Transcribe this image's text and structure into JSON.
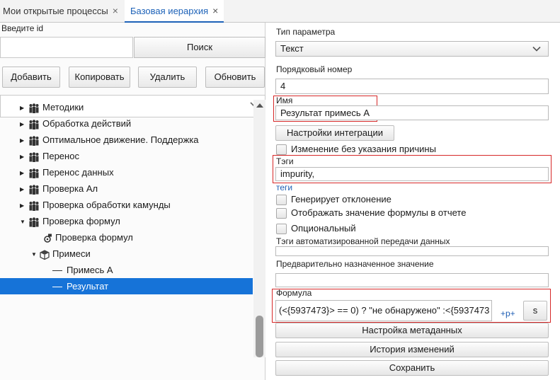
{
  "tabs": [
    {
      "label": "Мои открытые процессы",
      "close": "×"
    },
    {
      "label": "Базовая иерархия",
      "close": "×"
    }
  ],
  "left": {
    "id_label": "Введите id",
    "id_value": "",
    "search_label": "Поиск",
    "add_label": "Добавить",
    "copy_label": "Копировать",
    "delete_label": "Удалить",
    "refresh_label": "Обновить",
    "tree": [
      {
        "label": "Методики",
        "icon": "people-group-icon",
        "arrow": "▶"
      },
      {
        "label": "Обработка действий",
        "icon": "people-group-icon",
        "arrow": "▶"
      },
      {
        "label": "Оптимальное движение. Поддержка",
        "icon": "people-group-icon",
        "arrow": "▶"
      },
      {
        "label": "Перенос",
        "icon": "people-group-icon",
        "arrow": "▶"
      },
      {
        "label": "Перенос данных",
        "icon": "people-group-icon",
        "arrow": "▶"
      },
      {
        "label": "Проверка Ал",
        "icon": "people-group-icon",
        "arrow": "▶"
      },
      {
        "label": "Проверка обработки камунды",
        "icon": "people-group-icon",
        "arrow": "▶"
      },
      {
        "label": "Проверка формул",
        "icon": "people-group-icon",
        "arrow": "▼"
      },
      {
        "label": "Проверка формул",
        "icon": "gear-formula-icon",
        "arrow": ""
      },
      {
        "label": "Примеси",
        "icon": "cube-icon",
        "arrow": "▼"
      },
      {
        "label": "Примесь А",
        "icon": "dash-icon",
        "arrow": ""
      },
      {
        "label": "Результат",
        "icon": "dash-icon",
        "arrow": "",
        "selected": true
      }
    ]
  },
  "right": {
    "param_type_label": "Тип параметра",
    "param_type_value": "Текст",
    "order_label": "Порядковый номер",
    "order_value": "4",
    "name_label": "Имя",
    "name_value": "Результат примесь А",
    "integration_label": "Настройки интеграции",
    "no_reason_label": "Изменение без указания причины",
    "tags_label": "Тэги",
    "tags_value": "impurity,",
    "tags_link": "теги",
    "deviation_label": "Генерирует отклонение",
    "show_formula_label": "Отображать значение формулы в отчете",
    "optional_label": "Опциональный",
    "auto_tags_label": "Тэги автоматизированной передачи данных",
    "auto_tags_value": "",
    "preset_label": "Предварительно назначенное значение",
    "preset_value": "",
    "formula_label": "Формула",
    "formula_value": "(<{5937473}> == 0) ? \"не обнаружено\" :<{5937473",
    "plus_p_label": "+p+",
    "s_label": "s",
    "metadata_label": "Настройка метаданных",
    "history_label": "История изменений",
    "save_label": "Сохранить"
  },
  "colors": {
    "accent": "#1d62b8",
    "selection": "#1673d8",
    "highlight_border": "#d62828"
  }
}
